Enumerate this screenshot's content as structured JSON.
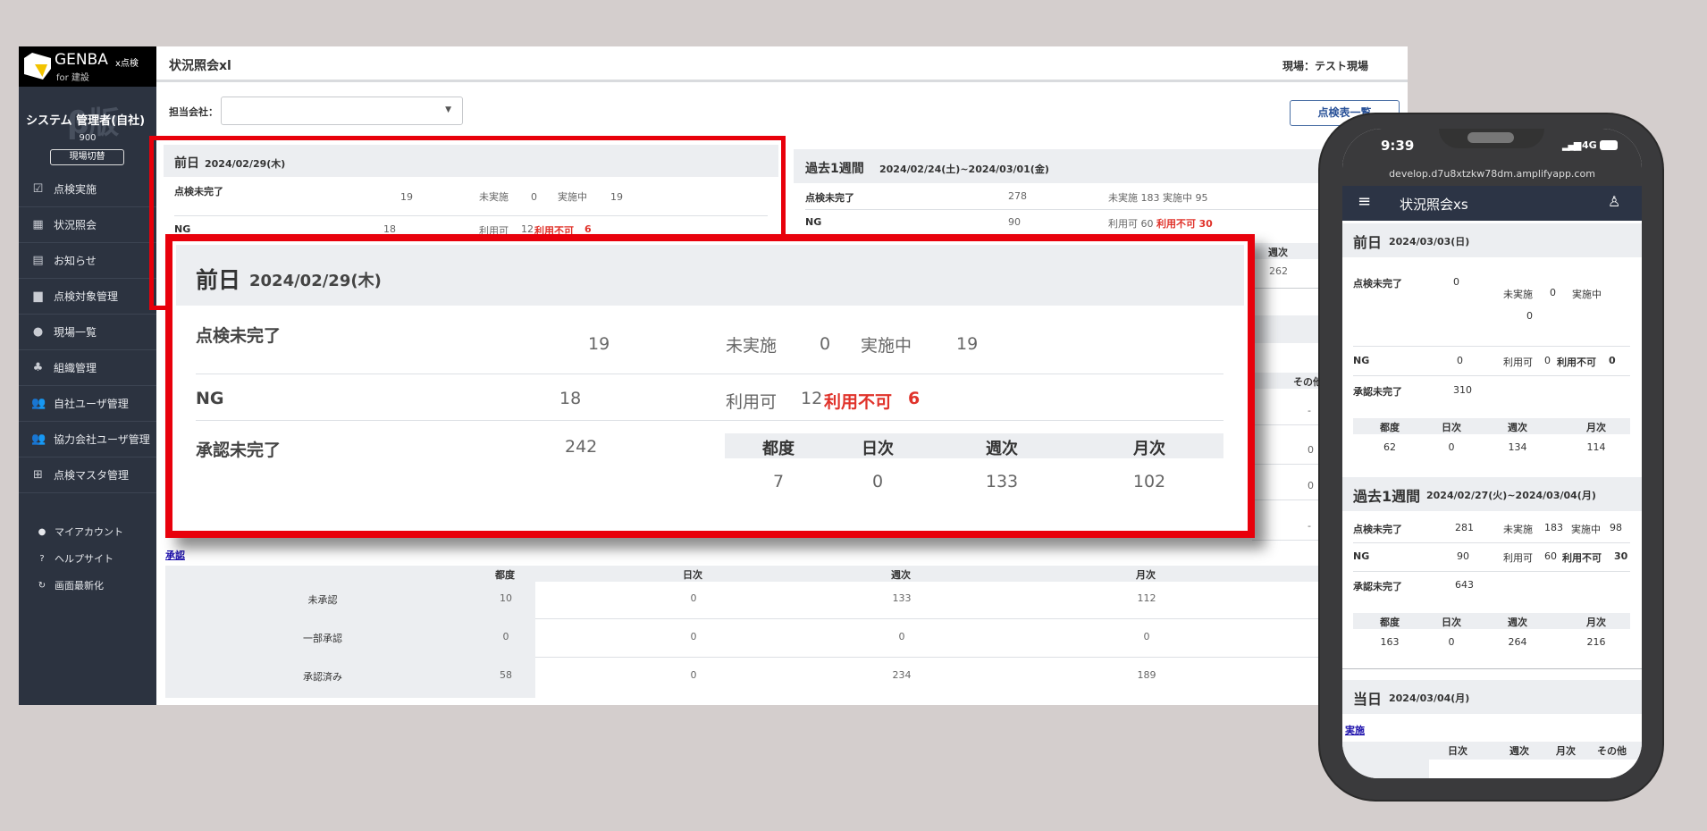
{
  "sidebar": {
    "logo_text": "GENBA",
    "logo_x": "x点検",
    "logo_sub": "for 建設",
    "watermark": "β版",
    "user_name": "システム 管理者(自社)",
    "user_code": "900",
    "switch_site": "現場切替",
    "items": [
      {
        "label": "点検実施",
        "icon": "clipboard-check-icon"
      },
      {
        "label": "状況照会",
        "icon": "status-grid-icon"
      },
      {
        "label": "お知らせ",
        "icon": "document-icon"
      },
      {
        "label": "点検対象管理",
        "icon": "toolbox-icon"
      },
      {
        "label": "現場一覧",
        "icon": "location-pin-icon"
      },
      {
        "label": "組織管理",
        "icon": "org-chart-icon"
      },
      {
        "label": "自社ユーザ管理",
        "icon": "users-icon"
      },
      {
        "label": "協力会社ユーザ管理",
        "icon": "partner-users-icon"
      },
      {
        "label": "点検マスタ管理",
        "icon": "table-icon"
      }
    ],
    "sub_items": [
      {
        "label": "マイアカウント",
        "icon": "person-icon"
      },
      {
        "label": "ヘルプサイト",
        "icon": "help-circle-icon"
      },
      {
        "label": "画面最新化",
        "icon": "refresh-icon"
      }
    ]
  },
  "header": {
    "title": "状況照会xl",
    "site": "現場：テスト現場"
  },
  "filter": {
    "company_label": "担当会社：",
    "company_value": "",
    "list_button": "点検表一覧"
  },
  "labels": {
    "incomplete": "点検未完了",
    "not_started": "未実施",
    "in_progress": "実施中",
    "ng": "NG",
    "usable": "利用可",
    "unusable": "利用不可",
    "unapproved": "承認未完了",
    "each": "都度",
    "daily": "日次",
    "weekly": "週次",
    "monthly": "月次",
    "other": "その他"
  },
  "prev_day": {
    "title": "前日",
    "date": "2024/02/29(木)",
    "incomplete": "19",
    "not_started": "0",
    "in_progress": "19",
    "ng": "18",
    "usable": "12",
    "unusable": "6",
    "unapproved": "242",
    "each": "7",
    "daily": "0",
    "weekly": "133",
    "monthly": "102"
  },
  "past_week": {
    "title": "過去1週間",
    "range": "2024/02/24(土)~2024/03/01(金)",
    "incomplete": "278",
    "not_started": "183",
    "in_progress": "95",
    "ng": "90",
    "usable": "60",
    "unusable": "30",
    "weekly": "262"
  },
  "right_partial": {
    "other_values": [
      "-",
      "0",
      "0",
      "-"
    ]
  },
  "approval": {
    "link": "承認",
    "columns": [
      "都度",
      "日次",
      "週次",
      "月次"
    ],
    "rows": [
      {
        "label": "未承認",
        "values": [
          "10",
          "0",
          "133",
          "112"
        ]
      },
      {
        "label": "一部承認",
        "values": [
          "0",
          "0",
          "0",
          "0"
        ]
      },
      {
        "label": "承認済み",
        "values": [
          "58",
          "0",
          "234",
          "189"
        ]
      }
    ]
  },
  "phone": {
    "time": "9:39",
    "network": "4G",
    "url": "develop.d7u8xtzkw78dm.amplifyapp.com",
    "title": "状況照会xs",
    "prev_day": {
      "title": "前日",
      "date": "2024/03/03(日)",
      "incomplete": "0",
      "not_started": "0",
      "in_progress": "0",
      "ng": "0",
      "usable": "0",
      "unusable": "0",
      "unapproved": "310",
      "each": "62",
      "daily": "0",
      "weekly": "134",
      "monthly": "114"
    },
    "past_week": {
      "title": "過去1週間",
      "range": "2024/02/27(火)~2024/03/04(月)",
      "incomplete": "281",
      "not_started": "183",
      "in_progress": "98",
      "ng": "90",
      "usable": "60",
      "unusable": "30",
      "unapproved": "643",
      "each": "163",
      "daily": "0",
      "weekly": "264",
      "monthly": "216"
    },
    "today": {
      "title": "当日",
      "date": "2024/03/04(月)",
      "link": "実施",
      "columns": [
        "日次",
        "週次",
        "月次",
        "その他"
      ]
    }
  },
  "colors": {
    "sidebar": "#2c3340",
    "highlight": "#e8000b",
    "alert": "#e0332b",
    "link": "#1a0dab"
  }
}
